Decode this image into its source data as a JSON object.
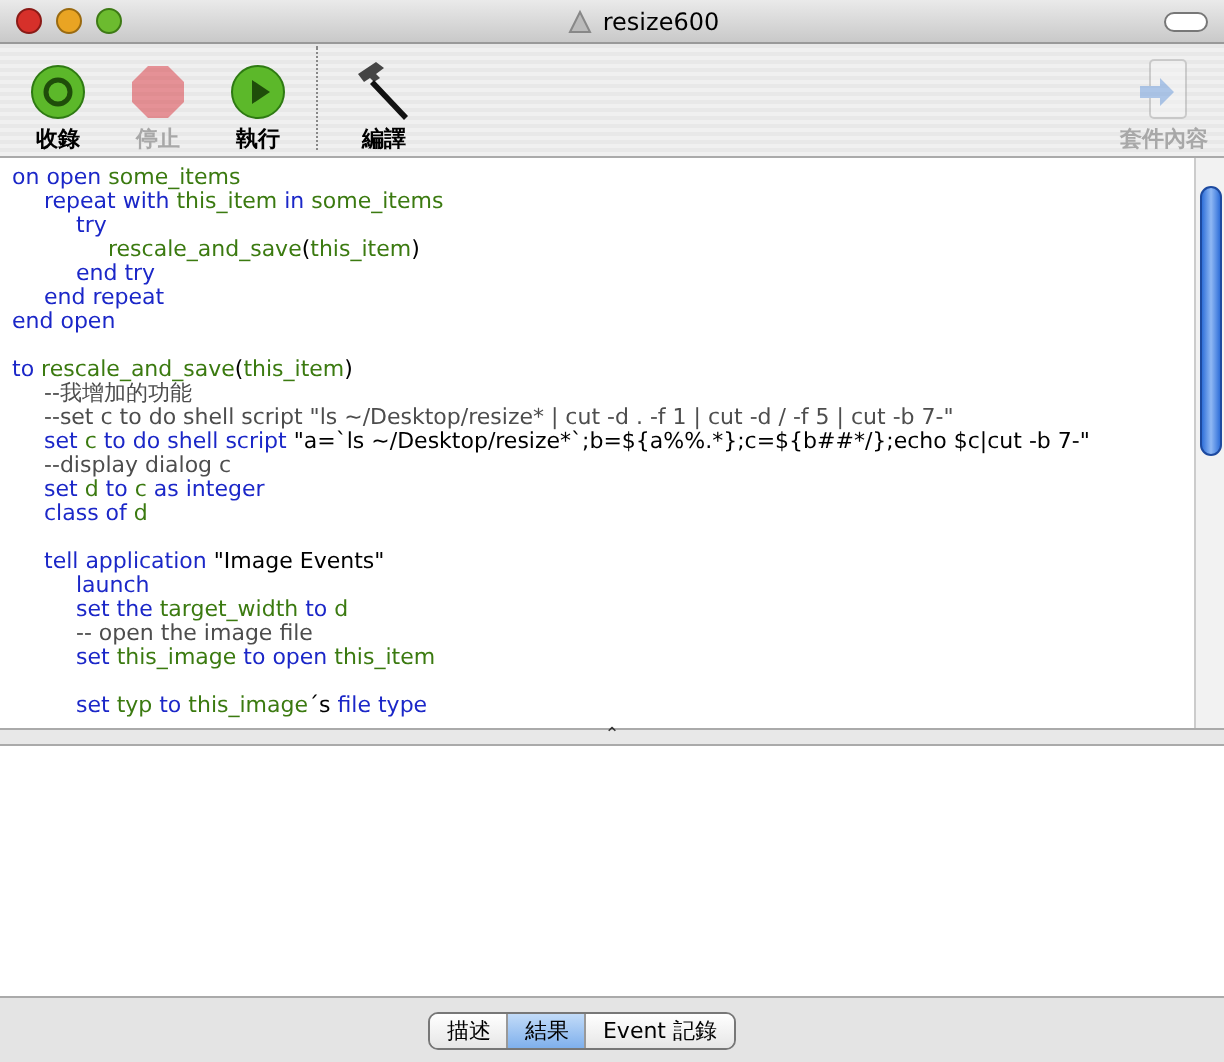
{
  "window": {
    "title": "resize600"
  },
  "toolbar": {
    "items": [
      {
        "kind": "record",
        "label": "收錄",
        "disabled": false
      },
      {
        "kind": "stop",
        "label": "停止",
        "disabled": true
      },
      {
        "kind": "run",
        "label": "執行",
        "disabled": false
      },
      {
        "kind": "compile",
        "label": "編譯",
        "disabled": false
      },
      {
        "kind": "bundle",
        "label": "套件內容",
        "disabled": true
      }
    ]
  },
  "script_lines": [
    {
      "tokens": [
        {
          "kind": "kw",
          "text": "on open "
        },
        {
          "kind": "var",
          "text": "some_items"
        }
      ],
      "children": [
        {
          "tokens": [
            {
              "kind": "kw",
              "text": "repeat with "
            },
            {
              "kind": "var",
              "text": "this_item"
            },
            {
              "kind": "kw",
              "text": " in "
            },
            {
              "kind": "var",
              "text": "some_items"
            }
          ],
          "children": [
            {
              "tokens": [
                {
                  "kind": "kw",
                  "text": "try"
                }
              ],
              "children": [
                {
                  "tokens": [
                    {
                      "kind": "var",
                      "text": "rescale_and_save"
                    },
                    {
                      "kind": "plain",
                      "text": "("
                    },
                    {
                      "kind": "var",
                      "text": "this_item"
                    },
                    {
                      "kind": "plain",
                      "text": ")"
                    }
                  ]
                }
              ]
            },
            {
              "tokens": [
                {
                  "kind": "kw",
                  "text": "end try"
                }
              ]
            }
          ]
        },
        {
          "tokens": [
            {
              "kind": "kw",
              "text": "end repeat"
            }
          ]
        }
      ]
    },
    {
      "tokens": [
        {
          "kind": "kw",
          "text": "end open"
        }
      ]
    },
    {
      "kind": "blank"
    },
    {
      "tokens": [
        {
          "kind": "kw",
          "text": "to "
        },
        {
          "kind": "var",
          "text": "rescale_and_save"
        },
        {
          "kind": "plain",
          "text": "("
        },
        {
          "kind": "var",
          "text": "this_item"
        },
        {
          "kind": "plain",
          "text": ")"
        }
      ],
      "children": [
        {
          "tokens": [
            {
              "kind": "comment",
              "text": "--我增加的功能"
            }
          ]
        },
        {
          "tokens": [
            {
              "kind": "comment",
              "text": "--set c to do shell script \"ls ~/Desktop/resize* | cut -d . -f 1 | cut -d / -f 5 | cut -b 7-\""
            }
          ]
        },
        {
          "tokens": [
            {
              "kind": "kw",
              "text": "set "
            },
            {
              "kind": "var",
              "text": "c"
            },
            {
              "kind": "kw",
              "text": " to do shell script "
            },
            {
              "kind": "plain",
              "text": "\"a=`ls ~/Desktop/resize*`;b=${a%%.*};c=${b##*/};echo $c|cut -b 7-\""
            }
          ]
        },
        {
          "tokens": [
            {
              "kind": "comment",
              "text": "--display dialog c"
            }
          ]
        },
        {
          "tokens": [
            {
              "kind": "kw",
              "text": "set "
            },
            {
              "kind": "var",
              "text": "d"
            },
            {
              "kind": "kw",
              "text": " to "
            },
            {
              "kind": "var",
              "text": "c"
            },
            {
              "kind": "kw",
              "text": " as integer"
            }
          ]
        },
        {
          "tokens": [
            {
              "kind": "kw",
              "text": "class of "
            },
            {
              "kind": "var",
              "text": "d"
            }
          ]
        },
        {
          "kind": "blank"
        },
        {
          "tokens": [
            {
              "kind": "kw",
              "text": "tell application "
            },
            {
              "kind": "plain",
              "text": "\"Image Events\""
            }
          ],
          "children": [
            {
              "tokens": [
                {
                  "kind": "kw",
                  "text": "launch"
                }
              ]
            },
            {
              "tokens": [
                {
                  "kind": "kw",
                  "text": "set the "
                },
                {
                  "kind": "var",
                  "text": "target_width"
                },
                {
                  "kind": "kw",
                  "text": " to "
                },
                {
                  "kind": "var",
                  "text": "d"
                }
              ]
            },
            {
              "tokens": [
                {
                  "kind": "comment",
                  "text": "-- open the image file"
                }
              ]
            },
            {
              "tokens": [
                {
                  "kind": "kw",
                  "text": "set "
                },
                {
                  "kind": "var",
                  "text": "this_image"
                },
                {
                  "kind": "kw",
                  "text": " to open "
                },
                {
                  "kind": "var",
                  "text": "this_item"
                }
              ]
            },
            {
              "kind": "blank"
            },
            {
              "tokens": [
                {
                  "kind": "kw",
                  "text": "set "
                },
                {
                  "kind": "var",
                  "text": "typ"
                },
                {
                  "kind": "kw",
                  "text": " to "
                },
                {
                  "kind": "var",
                  "text": "this_image"
                },
                {
                  "kind": "plain",
                  "text": "´s"
                },
                {
                  "kind": "kw",
                  "text": " file type"
                }
              ]
            }
          ]
        }
      ]
    }
  ],
  "splitter": {
    "symbol": "⌃"
  },
  "bottom_tabs": [
    {
      "label": "描述",
      "selected": false
    },
    {
      "label": "結果",
      "selected": true
    },
    {
      "label": "Event 記錄",
      "selected": false
    }
  ]
}
